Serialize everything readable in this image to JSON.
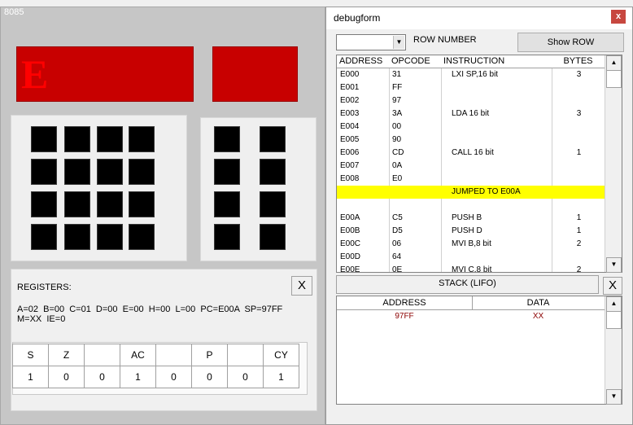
{
  "left_window": {
    "title": "8085",
    "address_display": "E",
    "registers": {
      "title": "REGISTERS:",
      "close_label": "X",
      "line1": "A=02  B=00  C=01  D=00  E=00  H=00  L=00  PC=E00A  SP=97FF",
      "line2": "M=XX  IE=0"
    },
    "flags": {
      "headers": [
        "S",
        "Z",
        "",
        "AC",
        "",
        "P",
        "",
        "CY"
      ],
      "values": [
        "1",
        "0",
        "0",
        "1",
        "0",
        "0",
        "0",
        "1"
      ]
    }
  },
  "debug_window": {
    "title": "debugform",
    "close_label": "x",
    "row_number_label": "ROW NUMBER",
    "show_row_label": "Show ROW",
    "columns": [
      "ADDRESS",
      "OPCODE",
      "INSTRUCTION",
      "BYTES"
    ],
    "rows": [
      {
        "address": "E000",
        "opcode": "31",
        "instruction": "LXI SP,16 bit",
        "bytes": "3"
      },
      {
        "address": "E001",
        "opcode": "FF",
        "instruction": "",
        "bytes": ""
      },
      {
        "address": "E002",
        "opcode": "97",
        "instruction": "",
        "bytes": ""
      },
      {
        "address": "E003",
        "opcode": "3A",
        "instruction": "LDA 16 bit",
        "bytes": "3"
      },
      {
        "address": "E004",
        "opcode": "00",
        "instruction": "",
        "bytes": ""
      },
      {
        "address": "E005",
        "opcode": "90",
        "instruction": "",
        "bytes": ""
      },
      {
        "address": "E006",
        "opcode": "CD",
        "instruction": "CALL 16 bit",
        "bytes": "1"
      },
      {
        "address": "E007",
        "opcode": "0A",
        "instruction": "",
        "bytes": ""
      },
      {
        "address": "E008",
        "opcode": "E0",
        "instruction": "",
        "bytes": ""
      },
      {
        "address": "",
        "opcode": "",
        "instruction": "JUMPED TO E00A",
        "bytes": "",
        "highlight": true
      },
      {
        "address": "",
        "opcode": "",
        "instruction": "",
        "bytes": ""
      },
      {
        "address": "E00A",
        "opcode": "C5",
        "instruction": "PUSH B",
        "bytes": "1"
      },
      {
        "address": "E00B",
        "opcode": "D5",
        "instruction": "PUSH D",
        "bytes": "1"
      },
      {
        "address": "E00C",
        "opcode": "06",
        "instruction": "MVI B,8 bit",
        "bytes": "2"
      },
      {
        "address": "E00D",
        "opcode": "64",
        "instruction": "",
        "bytes": ""
      },
      {
        "address": "E00E",
        "opcode": "0E",
        "instruction": "MVI C,8 bit",
        "bytes": "2"
      }
    ],
    "stack": {
      "title": "STACK (LIFO)",
      "close_label": "X",
      "columns": [
        "ADDRESS",
        "DATA"
      ],
      "rows": [
        {
          "address": "97FF",
          "data": "XX"
        }
      ]
    }
  },
  "colors": {
    "display_red": "#c80000",
    "highlight_yellow": "#ffff00",
    "stack_text": "#8b0000"
  }
}
